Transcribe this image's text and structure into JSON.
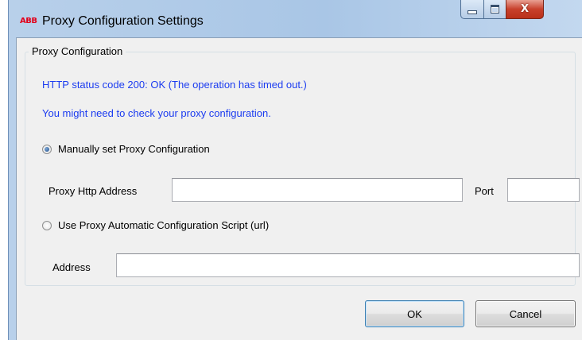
{
  "window": {
    "title": "Proxy Configuration Settings",
    "logo_text": "ABB",
    "controls": {
      "minimize": "minimize",
      "maximize": "maximize",
      "close": "X"
    }
  },
  "group": {
    "legend": "Proxy Configuration",
    "status_message": "HTTP status code 200: OK (The operation has timed out.)",
    "hint_message": "You might need to check your proxy configuration.",
    "manual_option": {
      "label": "Manually set Proxy Configuration",
      "selected": true
    },
    "proxy_http_address": {
      "label": "Proxy Http Address",
      "value": ""
    },
    "port": {
      "label": "Port",
      "value": ""
    },
    "auto_option": {
      "label": "Use Proxy Automatic Configuration Script (url)",
      "selected": false
    },
    "address": {
      "label": "Address",
      "value": ""
    }
  },
  "buttons": {
    "ok": "OK",
    "cancel": "Cancel"
  },
  "colors": {
    "status_text": "#1c3cf0",
    "logo": "#e2001a",
    "close_button": "#c8412c"
  }
}
